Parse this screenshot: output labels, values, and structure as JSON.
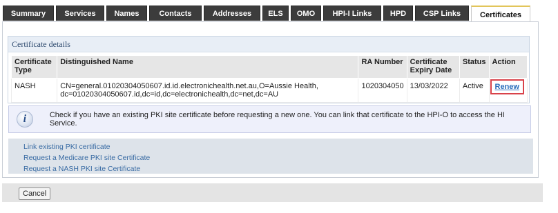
{
  "tabs": [
    {
      "label": "Summary",
      "active": false
    },
    {
      "label": "Services",
      "active": false
    },
    {
      "label": "Names",
      "active": false
    },
    {
      "label": "Contacts",
      "active": false
    },
    {
      "label": "Addresses",
      "active": false
    },
    {
      "label": "ELS",
      "active": false
    },
    {
      "label": "OMO",
      "active": false
    },
    {
      "label": "HPI-I Links",
      "active": false
    },
    {
      "label": "HPD",
      "active": false
    },
    {
      "label": "CSP Links",
      "active": false
    },
    {
      "label": "Certificates",
      "active": true
    }
  ],
  "certificate_details": {
    "title": "Certificate details",
    "columns": [
      "Certificate Type",
      "Distinguished Name",
      "RA Number",
      "Certificate Expiry Date",
      "Status",
      "Action"
    ],
    "rows": [
      {
        "type": "NASH",
        "distinguished_name": "CN=general.01020304050607.id.id.electronichealth.net.au,O=Aussie Health, dc=01020304050607.id,dc=id,dc=electronichealth,dc=net,dc=AU",
        "ra_number": "1020304050",
        "expiry_date": "13/03/2022",
        "status": "Active",
        "action": "Renew"
      }
    ]
  },
  "info": {
    "icon": "info-icon",
    "text": "Check if you have an existing PKI site certificate before requesting a new one. You can link that certificate to the HPI-O to access the HI Service."
  },
  "links": [
    "Link existing PKI certificate",
    "Request a Medicare PKI site Certificate",
    "Request a NASH PKI site Certificate"
  ],
  "footer": {
    "cancel_label": "Cancel"
  },
  "colors": {
    "tab_dark": "#3c3c3c",
    "active_tab_accent": "#e2c55a",
    "renew_highlight": "#d9424a",
    "link": "#3a6ca4"
  }
}
